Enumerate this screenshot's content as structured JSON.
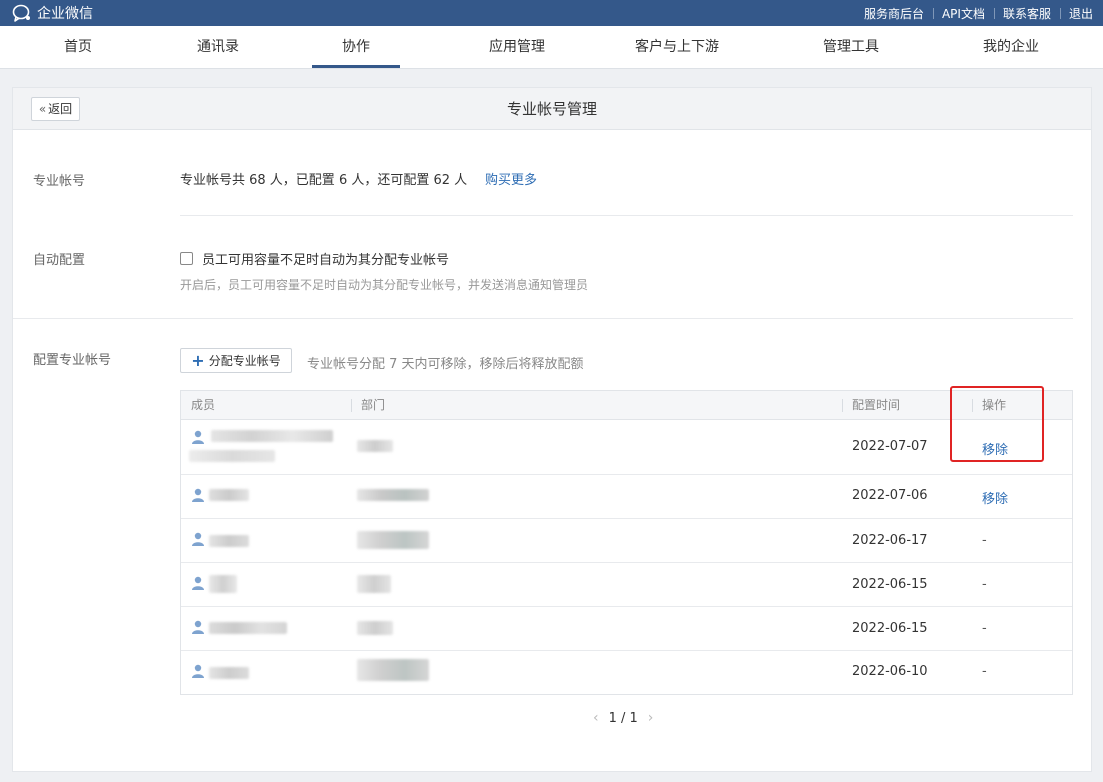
{
  "app": {
    "name": "企业微信",
    "top_links": [
      "服务商后台",
      "API文档",
      "联系客服",
      "退出"
    ]
  },
  "nav": {
    "items": [
      "首页",
      "通讯录",
      "协作",
      "应用管理",
      "客户与上下游",
      "管理工具",
      "我的企业"
    ],
    "active": "协作"
  },
  "page": {
    "back_label": "返回",
    "title": "专业帐号管理"
  },
  "sections": {
    "account": {
      "label": "专业帐号",
      "summary": "专业帐号共 68 人，已配置 6 人，还可配置 62 人",
      "buy_more": "购买更多"
    },
    "auto": {
      "label": "自动配置",
      "checkbox_label": "员工可用容量不足时自动为其分配专业帐号",
      "checked": false,
      "hint": "开启后，员工可用容量不足时自动为其分配专业帐号，并发送消息通知管理员"
    },
    "assign": {
      "label": "配置专业帐号",
      "button": "分配专业帐号",
      "hint": "专业帐号分配 7 天内可移除，移除后将释放配额"
    }
  },
  "table": {
    "columns": [
      "成员",
      "部门",
      "配置时间",
      "操作"
    ],
    "rows": [
      {
        "date": "2022-07-07",
        "action": "移除"
      },
      {
        "date": "2022-07-06",
        "action": "移除"
      },
      {
        "date": "2022-06-17",
        "action": "-"
      },
      {
        "date": "2022-06-15",
        "action": "-"
      },
      {
        "date": "2022-06-15",
        "action": "-"
      },
      {
        "date": "2022-06-10",
        "action": "-"
      }
    ]
  },
  "pagination": {
    "text": "1 / 1"
  },
  "colors": {
    "topbar": "#34588a",
    "link": "#2e6db4",
    "highlight": "#e02424"
  }
}
